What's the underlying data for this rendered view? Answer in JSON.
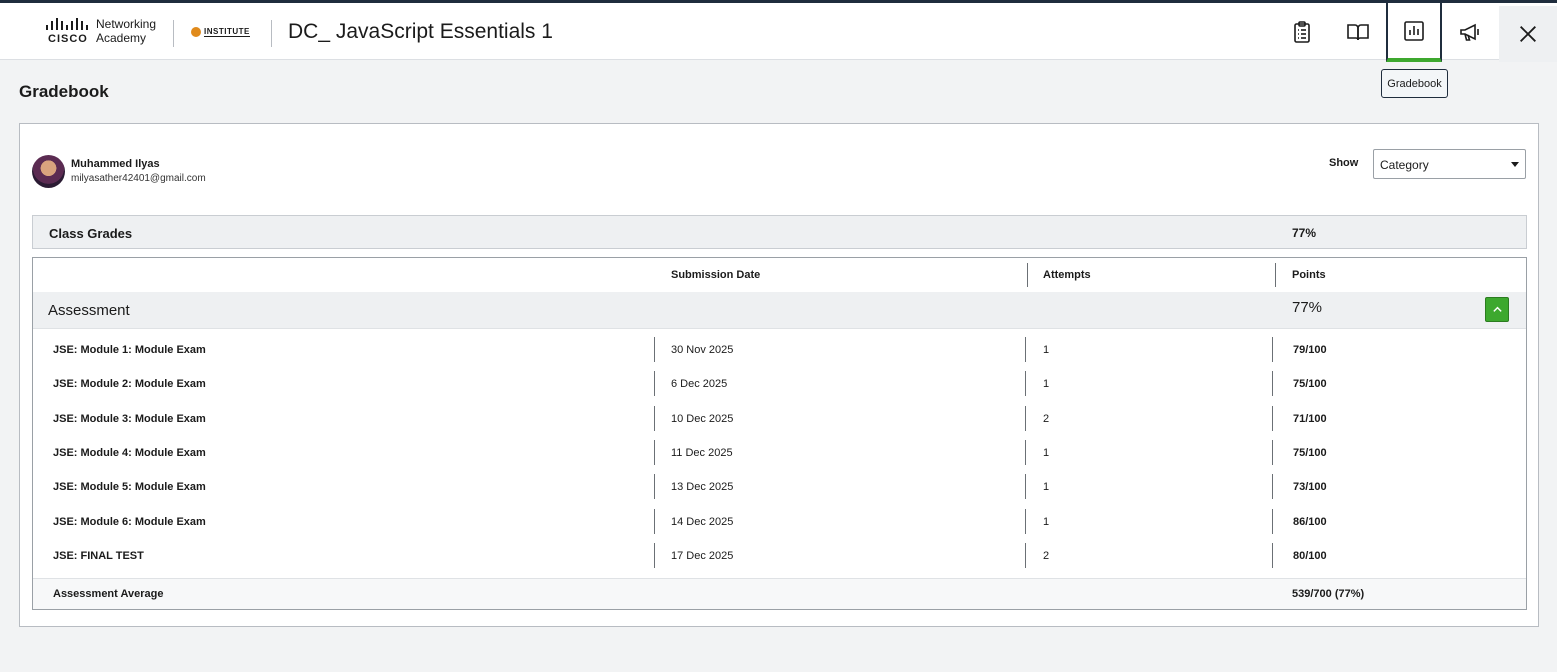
{
  "header": {
    "logo_brand": "CISCO",
    "logo_line1": "Networking",
    "logo_line2": "Academy",
    "institute_logo": "INSTITUTE",
    "course_title": "DC_ JavaScript Essentials 1",
    "icons": [
      "clipboard-list-icon",
      "book-open-icon",
      "bar-chart-icon",
      "megaphone-icon",
      "close-icon"
    ]
  },
  "tooltip": "Gradebook",
  "page_title": "Gradebook",
  "user": {
    "name": "Muhammed Ilyas",
    "email": "milyasather42401@gmail.com"
  },
  "show": {
    "label": "Show",
    "selected": "Category"
  },
  "class_grades": {
    "label": "Class Grades",
    "value": "77%"
  },
  "table": {
    "headers": {
      "submission_date": "Submission Date",
      "attempts": "Attempts",
      "points": "Points"
    },
    "section": {
      "label": "Assessment",
      "value": "77%"
    },
    "rows": [
      {
        "name": "JSE: Module 1: Module Exam",
        "date": "30 Nov 2025",
        "attempts": "1",
        "points": "79/100"
      },
      {
        "name": "JSE: Module 2: Module Exam",
        "date": "6 Dec 2025",
        "attempts": "1",
        "points": "75/100"
      },
      {
        "name": "JSE: Module 3: Module Exam",
        "date": "10 Dec 2025",
        "attempts": "2",
        "points": "71/100"
      },
      {
        "name": "JSE: Module 4: Module Exam",
        "date": "11 Dec 2025",
        "attempts": "1",
        "points": "75/100"
      },
      {
        "name": "JSE: Module 5: Module Exam",
        "date": "13 Dec 2025",
        "attempts": "1",
        "points": "73/100"
      },
      {
        "name": "JSE: Module 6: Module Exam",
        "date": "14 Dec 2025",
        "attempts": "1",
        "points": "86/100"
      },
      {
        "name": "JSE: FINAL TEST",
        "date": "17 Dec 2025",
        "attempts": "2",
        "points": "80/100"
      }
    ],
    "average": {
      "label": "Assessment Average",
      "value": "539/700 (77%)"
    }
  },
  "colors": {
    "accent_green": "#3da82e",
    "header_dark": "#1f2d3d",
    "page_bg": "#f2f3f4"
  }
}
